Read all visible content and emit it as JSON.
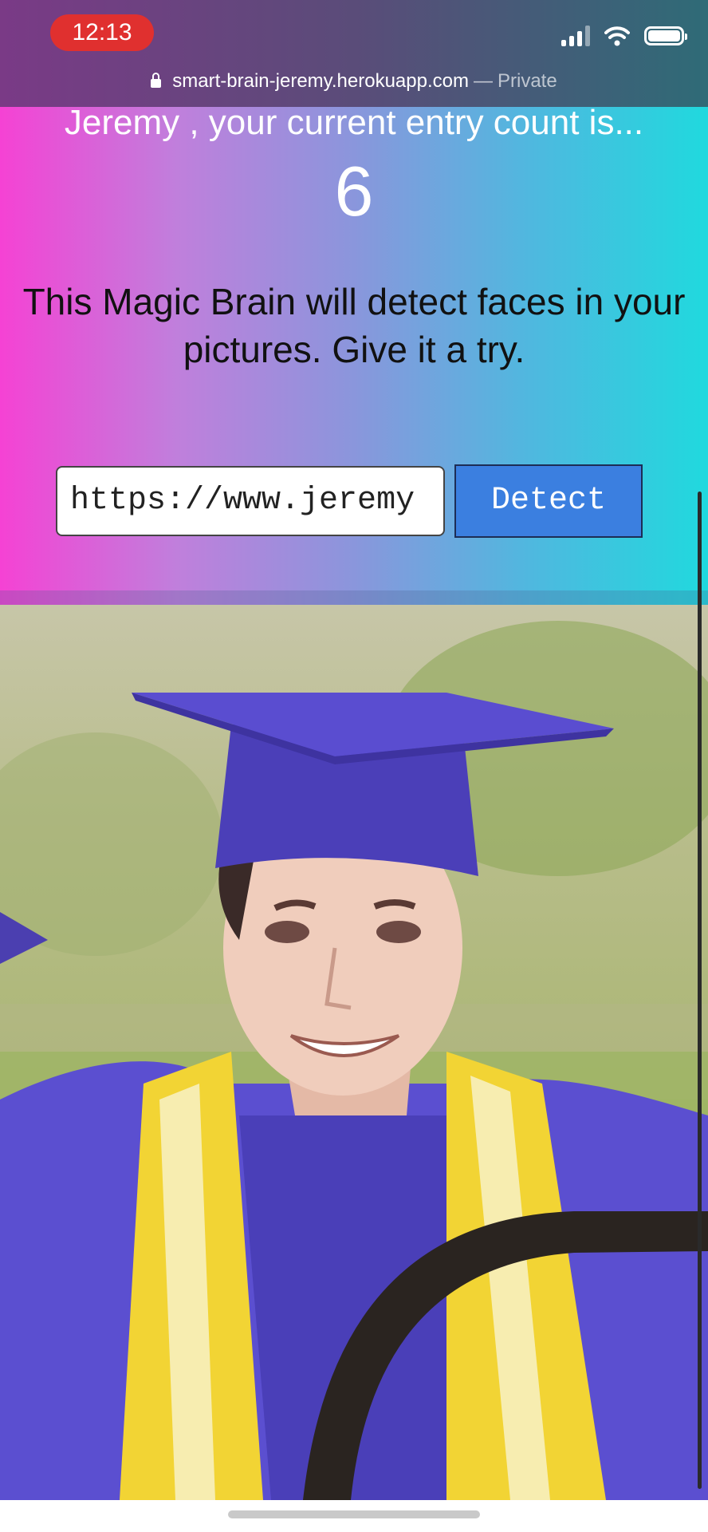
{
  "status_bar": {
    "time": "12:13",
    "icons": [
      "signal-icon",
      "wifi-icon",
      "battery-icon"
    ]
  },
  "browser": {
    "url": "smart-brain-jeremy.herokuapp.com",
    "separator": "—",
    "mode": "Private",
    "icon": "lock-icon"
  },
  "rank": {
    "message": "Jeremy , your current entry count is...",
    "count": "6"
  },
  "intro": {
    "text": "This Magic Brain will detect faces in your pictures. Give it a try."
  },
  "form": {
    "input_value": "https://www.jeremy",
    "button_label": "Detect",
    "button_color": "#3b7fe0"
  },
  "colors": {
    "gradient_left": "#f542d4",
    "gradient_right": "#20d9de"
  }
}
